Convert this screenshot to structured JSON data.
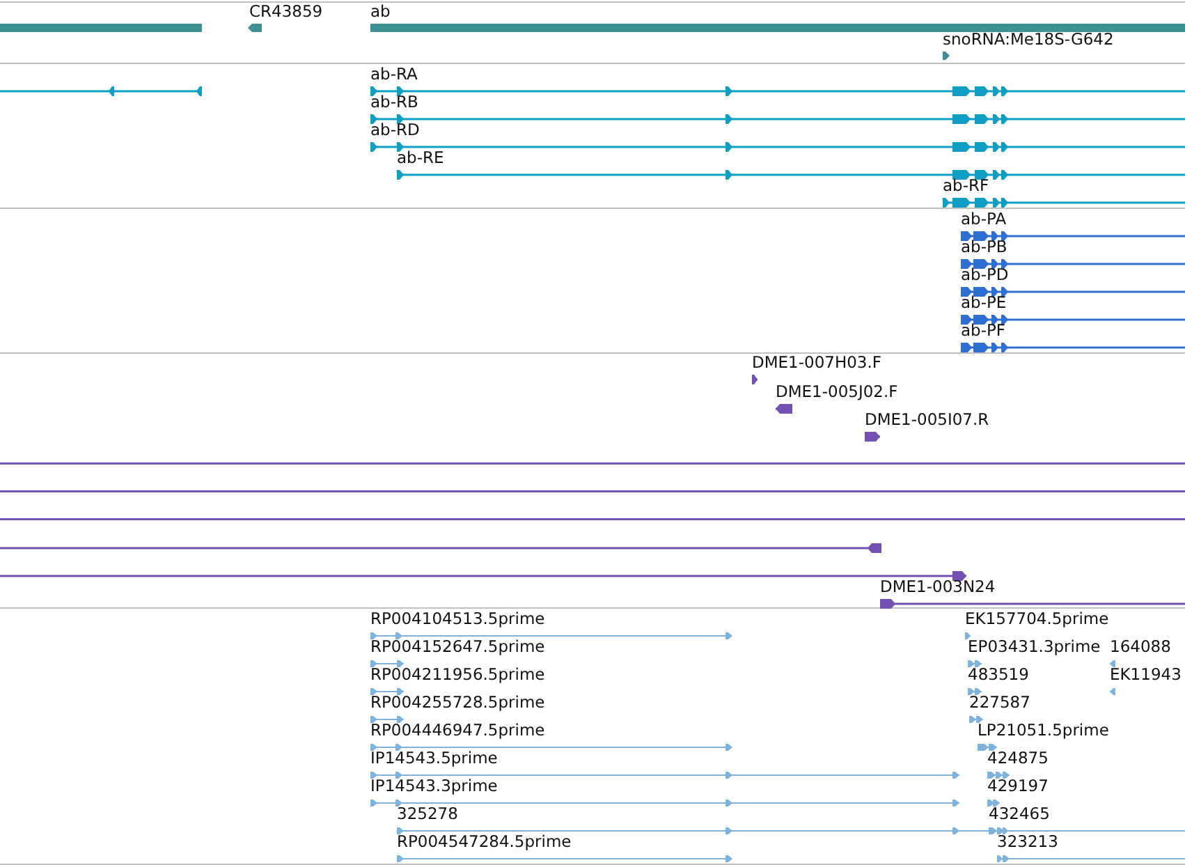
{
  "tracks": [
    {
      "kind": "gene",
      "color": "#3f9094",
      "features": [
        {
          "kind": "bar"
        },
        {
          "label": "CR43859",
          "reverse": true
        },
        {
          "label": "ab",
          "kind": "bar"
        },
        {
          "label": "snoRNA:Me18S-G642",
          "reverse": false
        }
      ]
    },
    {
      "kind": "transcript",
      "color": "#0e9fc2",
      "features": [
        {
          "reverse": true
        },
        {
          "label": "ab-RA",
          "reverse": false
        },
        {
          "label": "ab-RB",
          "reverse": false
        },
        {
          "label": "ab-RD",
          "reverse": false
        },
        {
          "label": "ab-RE",
          "reverse": false
        },
        {
          "label": "ab-RF",
          "reverse": false
        }
      ]
    },
    {
      "kind": "transcript",
      "color": "#2f6fd2",
      "features": [
        {
          "label": "ab-PA",
          "reverse": false
        },
        {
          "label": "ab-PB",
          "reverse": false
        },
        {
          "label": "ab-PD",
          "reverse": false
        },
        {
          "label": "ab-PE",
          "reverse": false
        },
        {
          "label": "ab-PF",
          "reverse": false
        }
      ]
    },
    {
      "kind": "clone",
      "color": "#7152b2",
      "features": [
        {
          "label": "DME1-007H03.F",
          "reverse": false
        },
        {
          "label": "DME1-005J02.F",
          "reverse": true
        },
        {
          "label": "DME1-005I07.R",
          "reverse": false
        },
        {
          "kind": "line"
        },
        {
          "kind": "line"
        },
        {
          "kind": "line"
        },
        {
          "reverse": true
        },
        {
          "reverse": false
        },
        {
          "label": "DME1-003N24",
          "reverse": false
        }
      ]
    },
    {
      "kind": "est",
      "color": "#7fb3dc",
      "features": [
        {
          "label": "RP004104513.5prime",
          "reverse": false
        },
        {
          "label": "RP004152647.5prime",
          "reverse": false
        },
        {
          "label": "RP004211956.5prime",
          "reverse": false
        },
        {
          "label": "RP004255728.5prime",
          "reverse": false
        },
        {
          "label": "RP004446947.5prime",
          "reverse": false
        },
        {
          "label": "IP14543.5prime",
          "reverse": false
        },
        {
          "label": "IP14543.3prime",
          "reverse": false
        },
        {
          "label": "325278",
          "reverse": false
        },
        {
          "label": "RP004547284.5prime",
          "reverse": false
        },
        {
          "label": "EK157704.5prime",
          "reverse": false
        },
        {
          "label": "EP03431.3prime",
          "reverse": false
        },
        {
          "label": "164088",
          "reverse": true
        },
        {
          "label": "483519",
          "reverse": false
        },
        {
          "label": "EK11943",
          "reverse": true
        },
        {
          "label": "227587",
          "reverse": false
        },
        {
          "label": "LP21051.5prime",
          "reverse": false
        },
        {
          "label": "424875",
          "reverse": false
        },
        {
          "label": "429197",
          "reverse": false
        },
        {
          "label": "432465",
          "reverse": false
        },
        {
          "label": "323213",
          "reverse": false
        }
      ]
    }
  ]
}
